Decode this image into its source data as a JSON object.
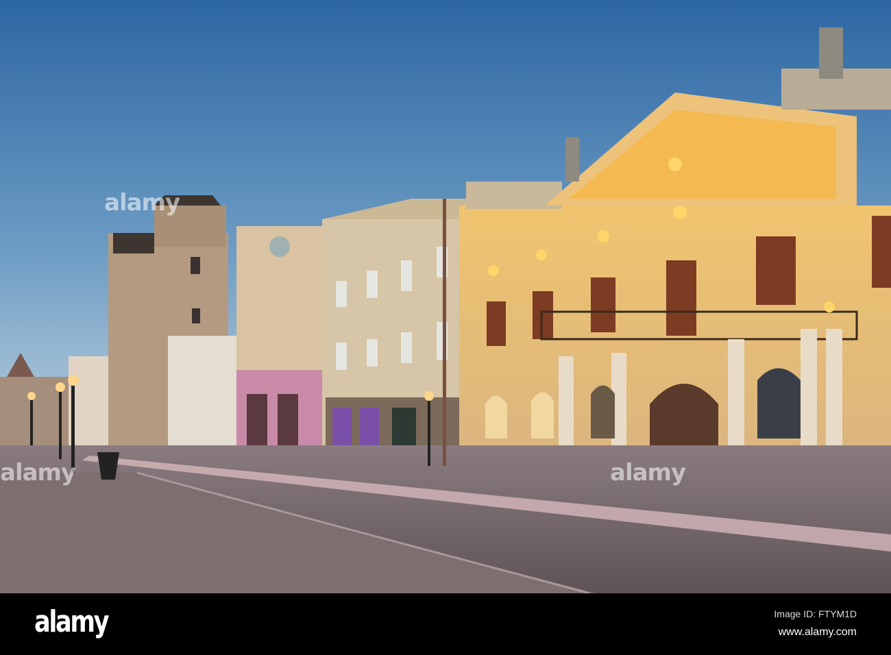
{
  "photo": {
    "subject": "Historic square street at dusk with lit baroque palace",
    "watermark_text": "alamy",
    "colors": {
      "sky_top": "#2c66a2",
      "sky_bottom": "#bcd0dc",
      "palace": "#e6c27c",
      "street": "#6b6064"
    }
  },
  "footer": {
    "logo": "alamy",
    "image_id": "Image ID: FTYM1D",
    "website": "www.alamy.com"
  }
}
